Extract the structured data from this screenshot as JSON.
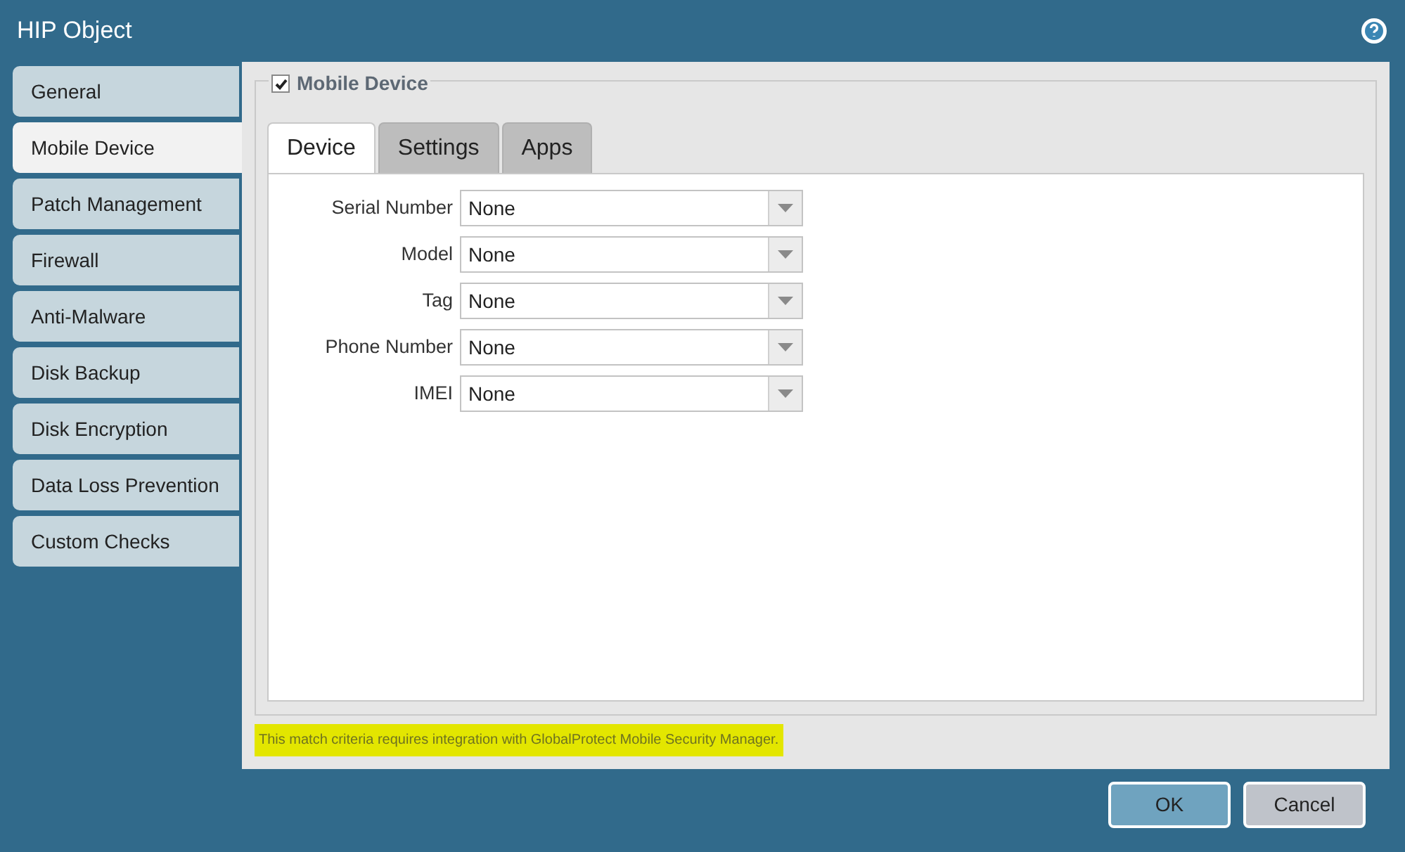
{
  "window": {
    "title": "HIP Object"
  },
  "sidebar": {
    "items": [
      {
        "label": "General",
        "selected": false
      },
      {
        "label": "Mobile Device",
        "selected": true
      },
      {
        "label": "Patch Management",
        "selected": false
      },
      {
        "label": "Firewall",
        "selected": false
      },
      {
        "label": "Anti-Malware",
        "selected": false
      },
      {
        "label": "Disk Backup",
        "selected": false
      },
      {
        "label": "Disk Encryption",
        "selected": false
      },
      {
        "label": "Data Loss Prevention",
        "selected": false
      },
      {
        "label": "Custom Checks",
        "selected": false
      }
    ]
  },
  "section": {
    "label": "Mobile Device",
    "checked": true
  },
  "tabs": [
    {
      "label": "Device",
      "selected": true
    },
    {
      "label": "Settings",
      "selected": false
    },
    {
      "label": "Apps",
      "selected": false
    }
  ],
  "fields": [
    {
      "label": "Serial Number",
      "value": "None"
    },
    {
      "label": "Model",
      "value": "None"
    },
    {
      "label": "Tag",
      "value": "None"
    },
    {
      "label": "Phone Number",
      "value": "None"
    },
    {
      "label": "IMEI",
      "value": "None"
    }
  ],
  "note": "This match criteria requires integration with GlobalProtect Mobile Security Manager.",
  "buttons": [
    {
      "label": "OK",
      "kind": "primary"
    },
    {
      "label": "Cancel",
      "kind": "secondary"
    }
  ]
}
